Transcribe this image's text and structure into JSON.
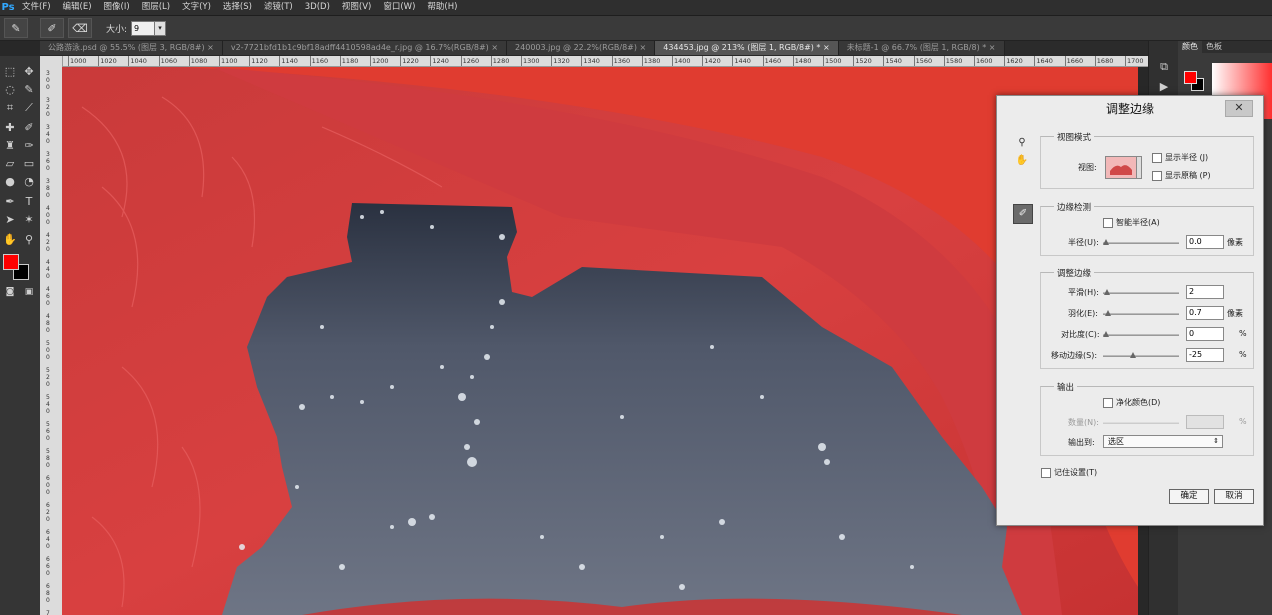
{
  "app": {
    "logo": "Ps"
  },
  "menu": [
    "文件(F)",
    "编辑(E)",
    "图像(I)",
    "图层(L)",
    "文字(Y)",
    "选择(S)",
    "滤镜(T)",
    "3D(D)",
    "视图(V)",
    "窗口(W)",
    "帮助(H)"
  ],
  "options": {
    "size_label": "大小:",
    "size_value": "9",
    "size_arrow": "▾"
  },
  "tabs": [
    {
      "label": "公路游泳.psd @ 55.5% (图层 3, RGB/8#) ×",
      "active": false
    },
    {
      "label": "v2-7721bfd1b1c9bf18adff4410598ad4e_r.jpg @ 16.7%(RGB/8#) ×",
      "active": false
    },
    {
      "label": "240003.jpg @ 22.2%(RGB/8#) ×",
      "active": false
    },
    {
      "label": "434453.jpg @ 213% (图层 1, RGB/8#) * ×",
      "active": true
    },
    {
      "label": "未标题-1 @ 66.7% (图层 1, RGB/8) * ×",
      "active": false
    }
  ],
  "ruler_top": [
    "1000",
    "1020",
    "1040",
    "1060",
    "1080",
    "1100",
    "1120",
    "1140",
    "1160",
    "1180",
    "1200",
    "1220",
    "1240",
    "1260",
    "1280",
    "1300",
    "1320",
    "1340",
    "1360",
    "1380",
    "1400",
    "1420",
    "1440",
    "1460",
    "1480",
    "1500",
    "1520",
    "1540",
    "1560",
    "1580",
    "1600",
    "1620",
    "1640",
    "1660",
    "1680",
    "1700"
  ],
  "ruler_left": [
    "300",
    "320",
    "340",
    "360",
    "380",
    "400",
    "420",
    "440",
    "460",
    "480",
    "500",
    "520",
    "540",
    "560",
    "580",
    "600",
    "620",
    "640",
    "660",
    "680",
    "700"
  ],
  "panel": {
    "tab_color": "颜色",
    "tab_swatches": "色板"
  },
  "colors": {
    "foreground": "#ff0000",
    "background": "#000000",
    "overlay_red": "#d43a3a",
    "dialog_bg": "#ececec"
  },
  "dialog": {
    "title": "调整边缘",
    "close": "✕",
    "view_mode": {
      "title": "视图模式",
      "view_label": "视图:",
      "show_radius": "显示半径 (J)",
      "show_original": "显示原稿 (P)"
    },
    "edge_detection": {
      "title": "边缘检测",
      "smart_radius": "智能半径(A)",
      "radius_label": "半径(U):",
      "radius_value": "0.0",
      "radius_unit": "像素",
      "radius_level": 0
    },
    "adjust_edge": {
      "title": "调整边缘",
      "smooth_label": "平滑(H):",
      "smooth_value": "2",
      "smooth_level": 2,
      "feather_label": "羽化(E):",
      "feather_value": "0.7",
      "feather_unit": "像素",
      "feather_level": 3,
      "contrast_label": "对比度(C):",
      "contrast_value": "0",
      "contrast_unit": "%",
      "contrast_level": 0,
      "shift_label": "移动边缘(S):",
      "shift_value": "-25",
      "shift_unit": "%",
      "shift_level": 38
    },
    "output": {
      "title": "输出",
      "decontaminate": "净化颜色(D)",
      "amount_label": "数量(N):",
      "amount_unit": "%",
      "output_to_label": "输出到:",
      "output_to_value": "选区"
    },
    "remember": "记住设置(T)",
    "ok": "确定",
    "cancel": "取消"
  }
}
